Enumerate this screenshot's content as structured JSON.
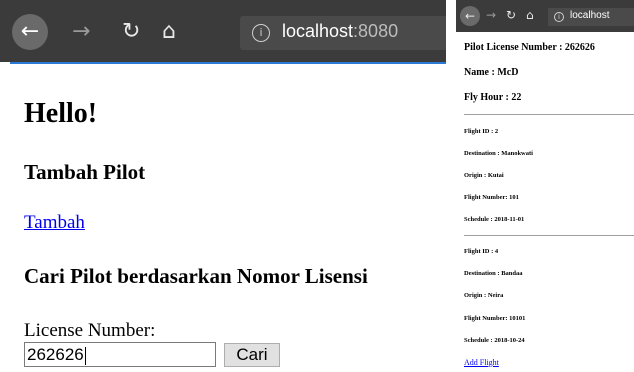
{
  "left_window": {
    "address_bar": {
      "host": "localhost",
      "port": ":8080"
    },
    "page": {
      "heading": "Hello!",
      "add_pilot_heading": "Tambah Pilot",
      "add_link": "Tambah",
      "search_heading": "Cari Pilot berdasarkan Nomor Lisensi",
      "license_label": "License Number:",
      "license_value": "262626",
      "search_button": "Cari"
    }
  },
  "right_window": {
    "address_bar": {
      "host": "localhost"
    },
    "pilot": {
      "license_line": "Pilot License Number : 262626",
      "name_line": "Name : McD",
      "fly_hour_line": "Fly Hour : 22"
    },
    "flights": [
      {
        "id_line": "Flight ID : 2",
        "destination_line": "Destination : Manokwati",
        "origin_line": "Origin : Kutai",
        "number_line": "Flight Number: 101",
        "schedule_line": "Schedule : 2018-11-01"
      },
      {
        "id_line": "Flight ID : 4",
        "destination_line": "Destination : Bandaa",
        "origin_line": "Origin : Neira",
        "number_line": "Flight Number: 10101",
        "schedule_line": "Schedule : 2018-10-24"
      }
    ],
    "add_flight_link": "Add Flight"
  },
  "icons": {
    "back": "back-arrow-icon",
    "forward": "forward-arrow-icon",
    "reload": "reload-icon",
    "home": "home-icon",
    "info": "info-icon"
  },
  "colors": {
    "browser_toolbar": "#3b3b3b",
    "link": "#0000ee",
    "address_text": "#ffffff"
  }
}
